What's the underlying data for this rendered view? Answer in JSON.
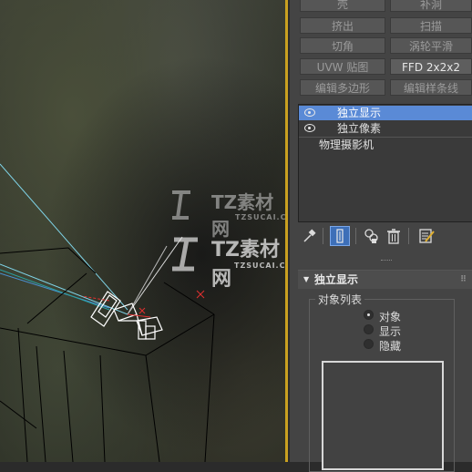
{
  "modifier_buttons": [
    {
      "label": "壳",
      "active": false
    },
    {
      "label": "补洞",
      "active": false
    },
    {
      "label": "挤出",
      "active": false
    },
    {
      "label": "扫描",
      "active": false
    },
    {
      "label": "切角",
      "active": false
    },
    {
      "label": "涡轮平滑",
      "active": false
    },
    {
      "label": "UVW 贴图",
      "active": false
    },
    {
      "label": "FFD 2x2x2",
      "active": true
    },
    {
      "label": "编辑多边形",
      "active": false
    },
    {
      "label": "编辑样条线",
      "active": false
    }
  ],
  "modifier_stack": [
    {
      "label": "独立显示",
      "selected": true,
      "eye": true
    },
    {
      "label": "独立像素",
      "selected": false,
      "eye": true
    },
    {
      "label": "物理摄影机",
      "selected": false,
      "eye": false
    }
  ],
  "stack_toolbar_icons": [
    "pin-stack-icon",
    "show-end-result-icon",
    "make-unique-icon",
    "remove-modifier-icon",
    "configure-modifier-sets-icon"
  ],
  "rollout": {
    "title": "独立显示",
    "group_title": "对象列表",
    "radios": [
      {
        "label": "对象",
        "checked": true
      },
      {
        "label": "显示",
        "checked": false
      },
      {
        "label": "隐藏",
        "checked": false
      }
    ]
  },
  "watermark": {
    "text": "TZ素材网",
    "sub": "TZSUCAI.COM"
  },
  "colors": {
    "selection": "#5a8ad6",
    "viewport_border": "#c9a020",
    "panel_bg": "#444444"
  }
}
